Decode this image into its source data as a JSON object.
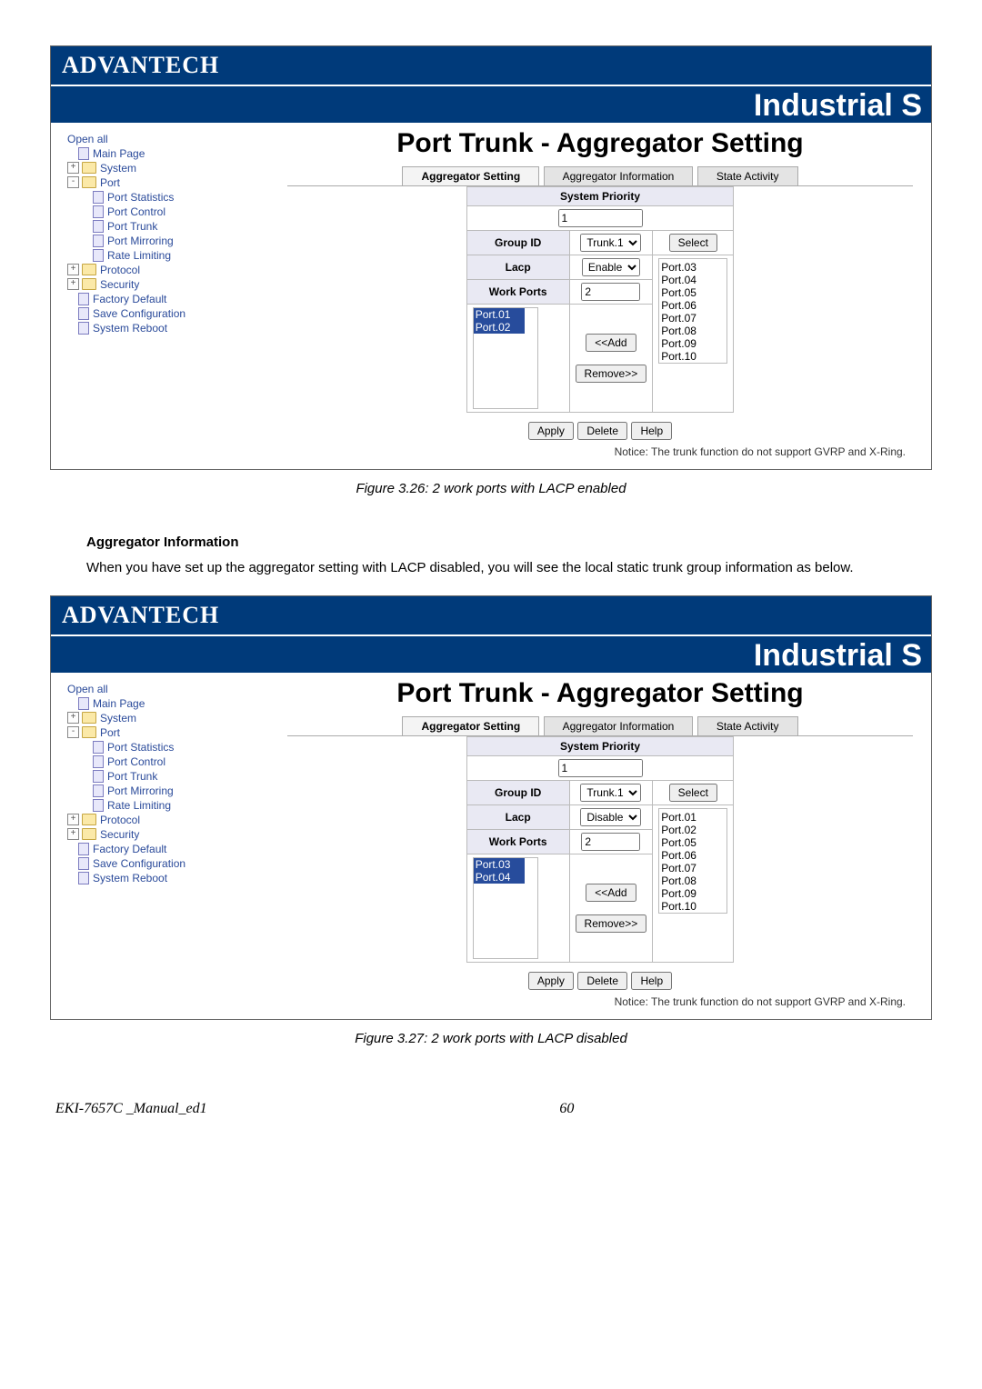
{
  "brand": "ADVANTECH",
  "banner": "Industrial S",
  "sidebar": {
    "open_all": "Open all",
    "main_page": "Main Page",
    "system": "System",
    "port": "Port",
    "port_statistics": "Port Statistics",
    "port_control": "Port Control",
    "port_trunk": "Port Trunk",
    "port_mirroring": "Port Mirroring",
    "rate_limiting": "Rate Limiting",
    "protocol": "Protocol",
    "security": "Security",
    "factory_default": "Factory Default",
    "save_configuration": "Save Configuration",
    "system_reboot": "System Reboot",
    "exp_plus": "+",
    "exp_minus": "-"
  },
  "main": {
    "title": "Port Trunk - Aggregator Setting",
    "tabs": {
      "setting": "Aggregator Setting",
      "info": "Aggregator Information",
      "state": "State Activity"
    },
    "system_priority_label": "System Priority",
    "system_priority_value": "1",
    "group_id_label": "Group ID",
    "group_id_value": "Trunk.1",
    "lacp_label": "Lacp",
    "work_ports_label": "Work Ports",
    "work_ports_value": "2",
    "select_label": "Select",
    "add_label": "<<Add",
    "remove_label": "Remove>>",
    "apply_label": "Apply",
    "delete_label": "Delete",
    "help_label": "Help",
    "notice": "Notice: The trunk function do not support GVRP and X-Ring."
  },
  "fig1": {
    "lacp_value": "Enable",
    "left_ports": [
      "Port.01",
      "Port.02"
    ],
    "right_ports": [
      "Port.03",
      "Port.04",
      "Port.05",
      "Port.06",
      "Port.07",
      "Port.08",
      "Port.09",
      "Port.10"
    ],
    "caption": "Figure 3.26: 2 work ports with LACP enabled"
  },
  "fig2": {
    "lacp_value": "Disable",
    "left_ports": [
      "Port.03",
      "Port.04"
    ],
    "right_ports": [
      "Port.01",
      "Port.02",
      "Port.05",
      "Port.06",
      "Port.07",
      "Port.08",
      "Port.09",
      "Port.10"
    ],
    "caption": "Figure 3.27: 2 work ports with LACP disabled"
  },
  "doc": {
    "section_heading": "Aggregator Information",
    "paragraph": "When you have set up the aggregator setting with LACP disabled, you will see the local static trunk group information as below.",
    "footer_left": "EKI-7657C _Manual_ed1",
    "footer_page": "60"
  }
}
